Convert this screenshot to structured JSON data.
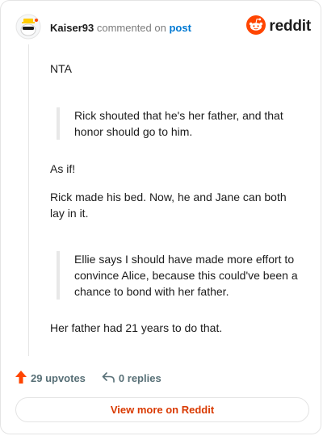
{
  "header": {
    "author": "Kaiser93",
    "verb": "commented on",
    "post_link": "post",
    "brand": "reddit"
  },
  "colors": {
    "brand_orange": "#ff4500",
    "link_blue": "#0079d3",
    "view_button_text": "#d93900",
    "muted": "#576f76"
  },
  "comment": {
    "p1": "NTA",
    "quote1": "Rick shouted that he's her father, and that honor should go to him.",
    "p2": "As if!",
    "p3": "Rick made his bed. Now, he and Jane can both lay in it.",
    "quote2": "Ellie says I should have made more effort to convince Alice, because this could've been a chance to bond with her father.",
    "p4": "Her father had 21 years to do that."
  },
  "actions": {
    "upvotes": "29 upvotes",
    "replies": "0 replies"
  },
  "view_button": "View more on Reddit",
  "icons": [
    "avatar-icon",
    "reddit-logo-icon",
    "upvote-arrow-icon",
    "reply-icon"
  ]
}
